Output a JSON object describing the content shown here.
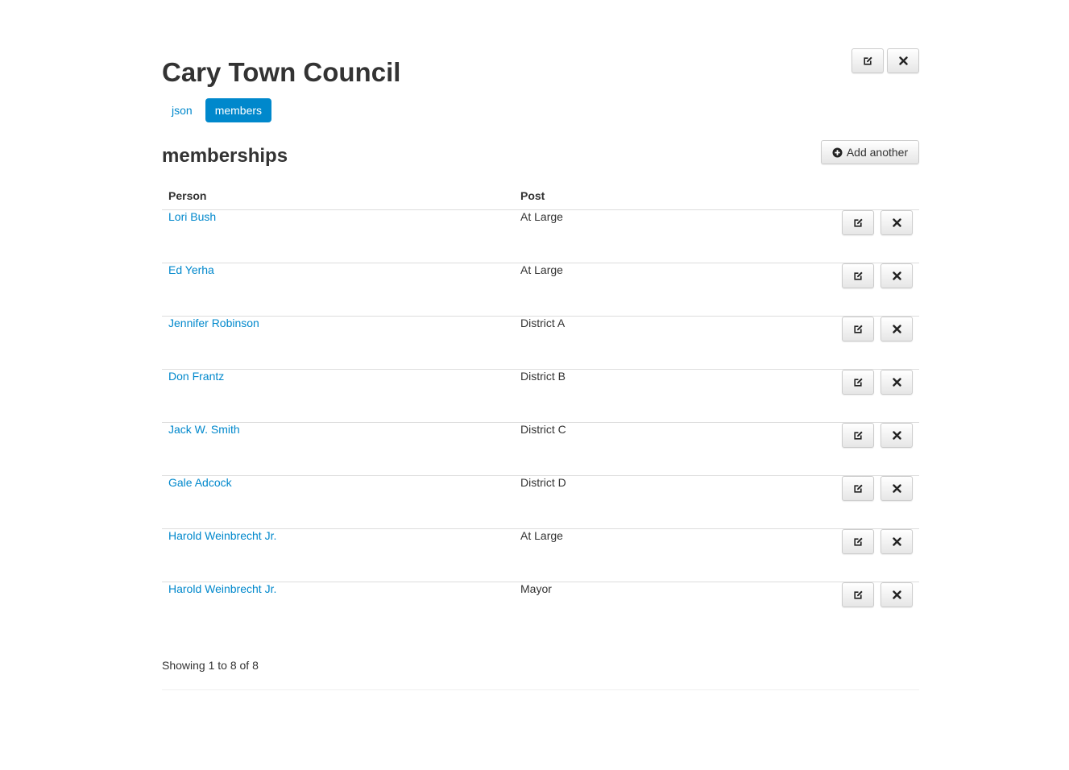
{
  "page": {
    "title": "Cary Town Council"
  },
  "tabs": [
    {
      "label": "json",
      "active": false
    },
    {
      "label": "members",
      "active": true
    }
  ],
  "toolbar": {
    "edit_icon": "edit-icon",
    "delete_icon": "close-icon"
  },
  "memberships": {
    "title": "memberships",
    "add_label": "Add another",
    "add_icon": "plus-circle-icon",
    "columns": [
      "Person",
      "Post",
      ""
    ],
    "rows": [
      {
        "person": "Lori Bush",
        "post": "At Large"
      },
      {
        "person": "Ed Yerha",
        "post": "At Large"
      },
      {
        "person": "Jennifer Robinson",
        "post": "District A"
      },
      {
        "person": "Don Frantz",
        "post": "District B"
      },
      {
        "person": "Jack W. Smith",
        "post": "District C"
      },
      {
        "person": "Gale Adcock",
        "post": "District D"
      },
      {
        "person": "Harold Weinbrecht Jr.",
        "post": "At Large"
      },
      {
        "person": "Harold Weinbrecht Jr.",
        "post": "Mayor"
      }
    ],
    "summary": "Showing 1 to 8 of 8"
  },
  "colors": {
    "link": "#0088cc",
    "active_pill": "#0088cc",
    "text": "#333333",
    "rule": "#dddddd"
  }
}
